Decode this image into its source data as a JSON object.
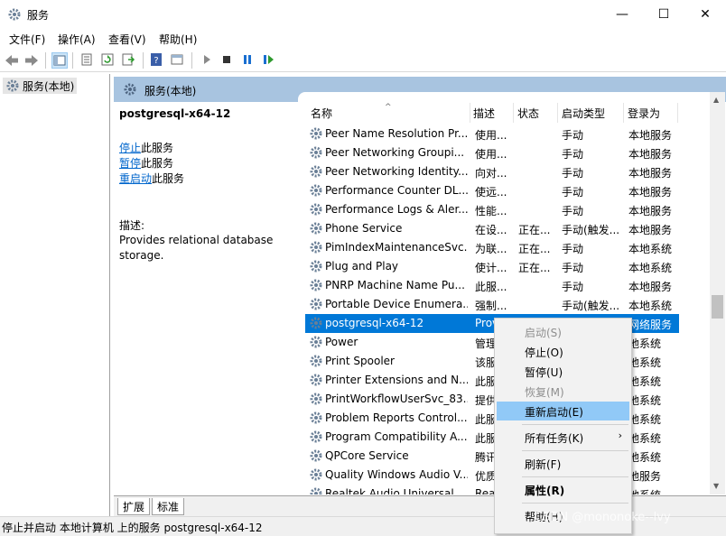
{
  "window": {
    "title": "服务",
    "minimize_glyph": "—",
    "maximize_glyph": "☐",
    "close_glyph": "✕"
  },
  "menu": [
    "文件(F)",
    "操作(A)",
    "查看(V)",
    "帮助(H)"
  ],
  "tree": {
    "root_label": "服务(本地)"
  },
  "pane_header": {
    "title": "服务(本地)"
  },
  "detail": {
    "service_name": "postgresql-x64-12",
    "actions": [
      {
        "link": "停止",
        "suffix": "此服务"
      },
      {
        "link": "暂停",
        "suffix": "此服务"
      },
      {
        "link": "重启动",
        "suffix": "此服务"
      }
    ],
    "description_label": "描述:",
    "description": "Provides relational database storage."
  },
  "columns": {
    "name": "名称",
    "description": "描述",
    "status": "状态",
    "startup": "启动类型",
    "logon": "登录为"
  },
  "rows": [
    {
      "name": "Peer Name Resolution Pr...",
      "desc": "使用...",
      "status": "",
      "startup": "手动",
      "logon": "本地服务"
    },
    {
      "name": "Peer Networking Groupi...",
      "desc": "使用...",
      "status": "",
      "startup": "手动",
      "logon": "本地服务"
    },
    {
      "name": "Peer Networking Identity...",
      "desc": "向对...",
      "status": "",
      "startup": "手动",
      "logon": "本地服务"
    },
    {
      "name": "Performance Counter DL...",
      "desc": "使远...",
      "status": "",
      "startup": "手动",
      "logon": "本地服务"
    },
    {
      "name": "Performance Logs & Aler...",
      "desc": "性能...",
      "status": "",
      "startup": "手动",
      "logon": "本地服务"
    },
    {
      "name": "Phone Service",
      "desc": "在设...",
      "status": "正在...",
      "startup": "手动(触发...",
      "logon": "本地服务"
    },
    {
      "name": "PimIndexMaintenanceSvc...",
      "desc": "为联...",
      "status": "正在...",
      "startup": "手动",
      "logon": "本地系统"
    },
    {
      "name": "Plug and Play",
      "desc": "使计...",
      "status": "正在...",
      "startup": "手动",
      "logon": "本地系统"
    },
    {
      "name": "PNRP Machine Name Pu...",
      "desc": "此服...",
      "status": "",
      "startup": "手动",
      "logon": "本地服务"
    },
    {
      "name": "Portable Device Enumera...",
      "desc": "强制...",
      "status": "",
      "startup": "手动(触发...",
      "logon": "本地系统"
    },
    {
      "name": "postgresql-x64-12",
      "desc": "Prov",
      "status": "",
      "startup": "",
      "logon": "网络服务"
    },
    {
      "name": "Power",
      "desc": "管理",
      "status": "",
      "startup": "",
      "logon": "地系统"
    },
    {
      "name": "Print Spooler",
      "desc": "该服",
      "status": "",
      "startup": "",
      "logon": "地系统"
    },
    {
      "name": "Printer Extensions and N...",
      "desc": "此服",
      "status": "",
      "startup": "",
      "logon": "地系统"
    },
    {
      "name": "PrintWorkflowUserSvc_83...",
      "desc": "提供",
      "status": "",
      "startup": "",
      "logon": "地系统"
    },
    {
      "name": "Problem Reports Control...",
      "desc": "此服",
      "status": "",
      "startup": "",
      "logon": "地系统"
    },
    {
      "name": "Program Compatibility A...",
      "desc": "此服",
      "status": "",
      "startup": "",
      "logon": "地系统"
    },
    {
      "name": "QPCore Service",
      "desc": "腾讯",
      "status": "",
      "startup": "",
      "logon": "地系统"
    },
    {
      "name": "Quality Windows Audio V...",
      "desc": "优质",
      "status": "",
      "startup": "",
      "logon": "地服务"
    },
    {
      "name": "Realtek Audio Universal ...",
      "desc": "Rea",
      "status": "",
      "startup": "",
      "logon": "地系统"
    }
  ],
  "selected_row": 10,
  "context_menu": [
    {
      "label": "启动(S)",
      "disabled": true
    },
    {
      "label": "停止(O)"
    },
    {
      "label": "暂停(U)"
    },
    {
      "label": "恢复(M)",
      "disabled": true
    },
    {
      "label": "重新启动(E)",
      "highlighted": true
    },
    {
      "label": "所有任务(K)",
      "submenu_arrow": "›"
    },
    {
      "label": "刷新(F)"
    },
    {
      "label": "属性(R)",
      "bold": true
    },
    {
      "label": "帮助(H)"
    }
  ],
  "tabs": [
    "扩展",
    "标准"
  ],
  "status_bar": "停止并启动 本地计算机 上的服务 postgresql-x64-12",
  "watermark": "CSDN @mononoke--lvy",
  "colors": {
    "selection": "#0078d7",
    "header_band": "#a8c4e0",
    "menu_highlight": "#91c9f7",
    "link": "#0066cc"
  }
}
